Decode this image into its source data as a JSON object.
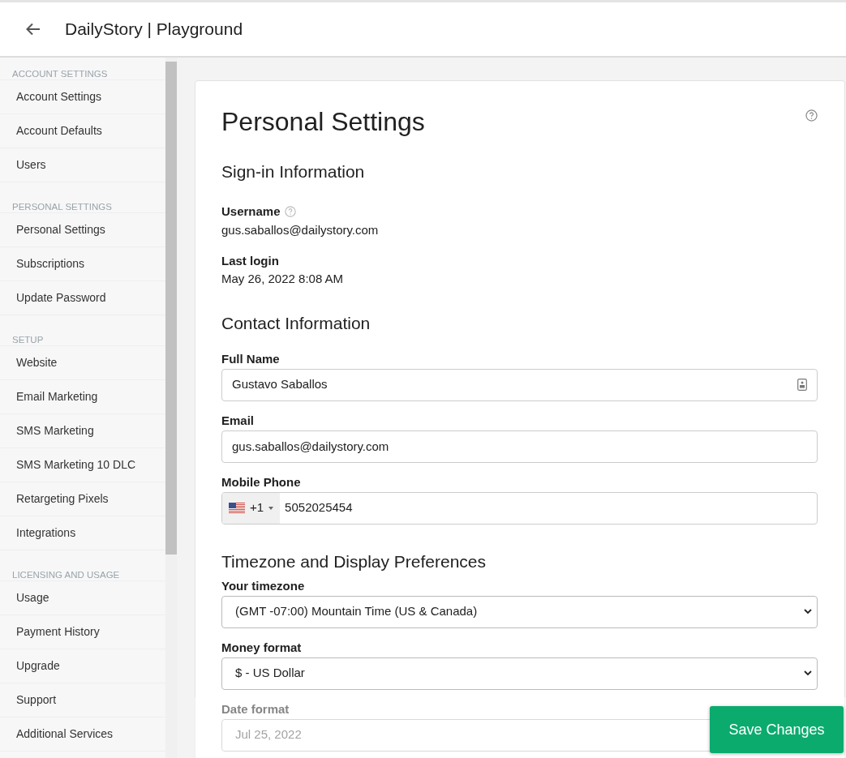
{
  "header": {
    "title": "DailyStory | Playground"
  },
  "sidebar": {
    "groups": [
      {
        "heading": "ACCOUNT SETTINGS",
        "items": [
          "Account Settings",
          "Account Defaults",
          "Users"
        ]
      },
      {
        "heading": "PERSONAL SETTINGS",
        "items": [
          "Personal Settings",
          "Subscriptions",
          "Update Password"
        ]
      },
      {
        "heading": "SETUP",
        "items": [
          "Website",
          "Email Marketing",
          "SMS Marketing",
          "SMS Marketing 10 DLC",
          "Retargeting Pixels",
          "Integrations"
        ]
      },
      {
        "heading": "LICENSING AND USAGE",
        "items": [
          "Usage",
          "Payment History",
          "Upgrade",
          "Support",
          "Additional Services"
        ]
      }
    ]
  },
  "page": {
    "title": "Personal Settings",
    "sign_in": {
      "heading": "Sign-in Information",
      "username_label": "Username",
      "username": "gus.saballos@dailystory.com",
      "last_login_label": "Last login",
      "last_login": "May 26, 2022 8:08 AM"
    },
    "contact": {
      "heading": "Contact Information",
      "full_name_label": "Full Name",
      "full_name": "Gustavo Saballos",
      "email_label": "Email",
      "email": "gus.saballos@dailystory.com",
      "phone_label": "Mobile Phone",
      "country_code": "+1",
      "phone": "5052025454"
    },
    "preferences": {
      "heading": "Timezone and Display Preferences",
      "timezone_label": "Your timezone",
      "timezone": "(GMT -07:00) Mountain Time (US & Canada)",
      "money_label": "Money format",
      "money": "$ - US Dollar",
      "date_label": "Date format",
      "date": "Jul 25, 2022"
    }
  },
  "footer": {
    "save_button": "Save Changes"
  }
}
